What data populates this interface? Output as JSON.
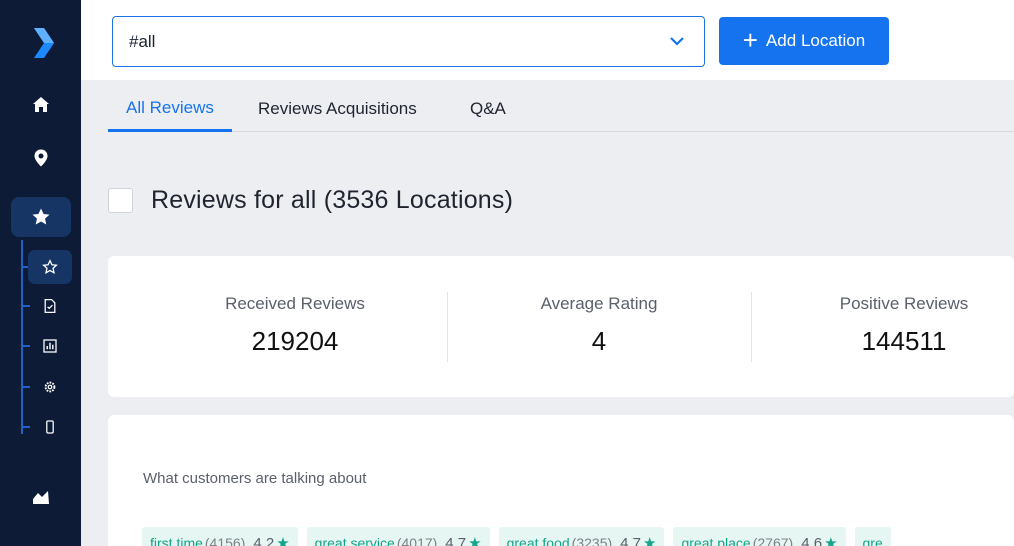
{
  "colors": {
    "sidebar": "#0d1b36",
    "accent": "#1673f0",
    "chip_bg": "#e6f6f2",
    "chip_text": "#12a58a"
  },
  "sidebar": {
    "main_items": [
      {
        "icon": "home-icon"
      },
      {
        "icon": "location-pin-icon"
      },
      {
        "icon": "star-icon",
        "active": true
      },
      {
        "icon": "chart-area-icon"
      }
    ],
    "sub_items": [
      {
        "icon": "star-outline-icon",
        "active": true
      },
      {
        "icon": "document-check-icon"
      },
      {
        "icon": "bar-chart-icon"
      },
      {
        "icon": "gear-icon"
      },
      {
        "icon": "mobile-icon"
      }
    ]
  },
  "topbar": {
    "location_select": {
      "value": "#all"
    },
    "add_location_label": "Add Location",
    "add_icon": "plus-icon"
  },
  "tabs": [
    {
      "label": "All Reviews",
      "active": true
    },
    {
      "label": "Reviews Acquisitions"
    },
    {
      "label": "Q&A"
    }
  ],
  "page": {
    "title": "Reviews for all (3536 Locations)"
  },
  "stats": [
    {
      "label": "Received Reviews",
      "value": "219204"
    },
    {
      "label": "Average Rating",
      "value": "4"
    },
    {
      "label": "Positive Reviews",
      "value": "144511"
    }
  ],
  "topics": {
    "heading": "What customers are talking about",
    "chips": [
      {
        "name": "first time",
        "count": "(4156)",
        "rating": "4.2"
      },
      {
        "name": "great service",
        "count": "(4017)",
        "rating": "4.7"
      },
      {
        "name": "great food",
        "count": "(3235)",
        "rating": "4.7"
      },
      {
        "name": "great place",
        "count": "(2767)",
        "rating": "4.6"
      },
      {
        "name": "gre",
        "count": "",
        "rating": ""
      }
    ]
  }
}
